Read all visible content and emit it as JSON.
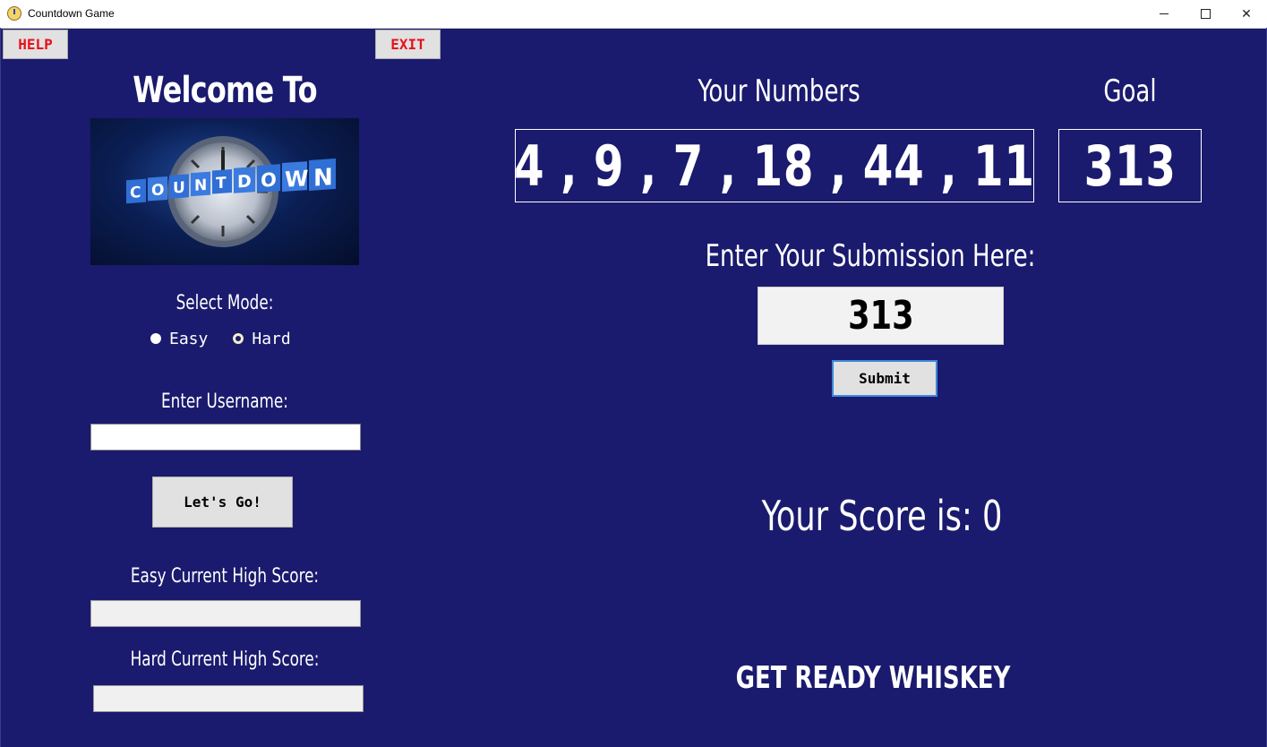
{
  "window": {
    "title": "Countdown Game",
    "icon": "clock-icon"
  },
  "toolbar": {
    "help_label": "HELP",
    "exit_label": "EXIT"
  },
  "sidebar": {
    "welcome": "Welcome To",
    "logo_text": "COUNTDOWN",
    "select_mode_label": "Select Mode:",
    "modes": [
      {
        "label": "Easy",
        "selected": false
      },
      {
        "label": "Hard",
        "selected": true
      }
    ],
    "username_label": "Enter Username:",
    "username_value": "",
    "go_label": "Let's Go!",
    "easy_high_score_label": "Easy Current High Score:",
    "easy_high_score_value": "",
    "hard_high_score_label": "Hard Current High Score:",
    "hard_high_score_value": ""
  },
  "game": {
    "numbers_label": "Your Numbers",
    "numbers_value": "4 , 9 , 7 , 18 , 44 , 11",
    "goal_label": "Goal",
    "goal_value": "313",
    "submission_label": "Enter Your Submission Here:",
    "submission_value": "313",
    "submit_label": "Submit",
    "score_text": "Your Score is: 0",
    "status_text": "GET READY WHISKEY"
  },
  "colors": {
    "background": "#1a1a6e",
    "text": "#ffffff",
    "button_red_text": "#e8101a",
    "submit_focus_border": "#3c8ad8"
  }
}
